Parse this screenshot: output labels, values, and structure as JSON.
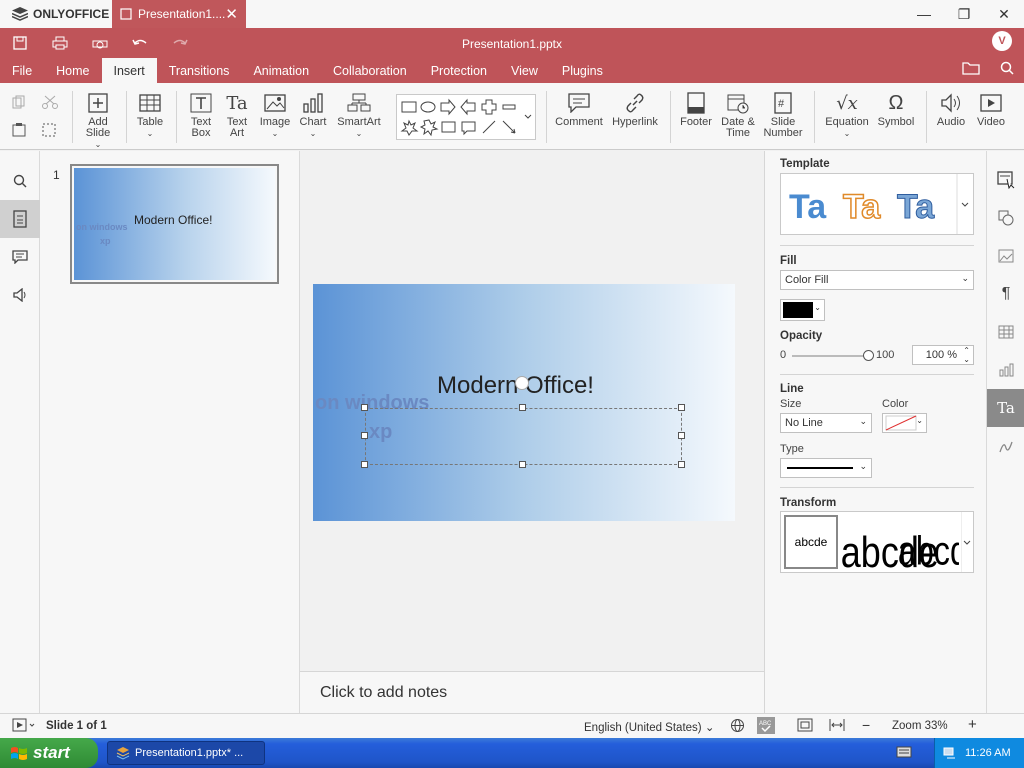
{
  "app": {
    "brand": "ONLYOFFICE",
    "tab_title": "Presentation1....",
    "doc_title": "Presentation1.pptx",
    "user_initial": "V"
  },
  "menu": [
    "File",
    "Home",
    "Insert",
    "Transitions",
    "Animation",
    "Collaboration",
    "Protection",
    "View",
    "Plugins"
  ],
  "menu_active": "Insert",
  "toolbar": {
    "add_slide": "Add Slide",
    "table": "Table",
    "text_box": "Text Box",
    "text_art": "Text Art",
    "image": "Image",
    "chart": "Chart",
    "smartart": "SmartArt",
    "comment": "Comment",
    "hyperlink": "Hyperlink",
    "footer": "Footer",
    "date_time": "Date & Time",
    "slide_number": "Slide Number",
    "equation": "Equation",
    "symbol": "Symbol",
    "audio": "Audio",
    "video": "Video"
  },
  "thumbs": {
    "number": "1",
    "title": "Modern Office!",
    "shadow1": "on windows",
    "shadow2": "xp"
  },
  "slide": {
    "title": "Modern Office!",
    "shadow1": "on windows",
    "shadow2": "xp"
  },
  "notes": "Click to add notes",
  "right_panel": {
    "template": "Template",
    "fill": "Fill",
    "fill_type": "Color Fill",
    "opacity": "Opacity",
    "opacity_min": "0",
    "opacity_max": "100",
    "opacity_value": "100 %",
    "line": "Line",
    "size": "Size",
    "color": "Color",
    "size_value": "No Line",
    "type": "Type",
    "transform": "Transform",
    "transform_sample": "abcde"
  },
  "status": {
    "slide_of": "Slide 1 of 1",
    "language": "English (United States)",
    "zoom": "Zoom 33%"
  },
  "taskbar": {
    "start": "start",
    "task": "Presentation1.pptx* ...",
    "time": "11:26 AM"
  }
}
